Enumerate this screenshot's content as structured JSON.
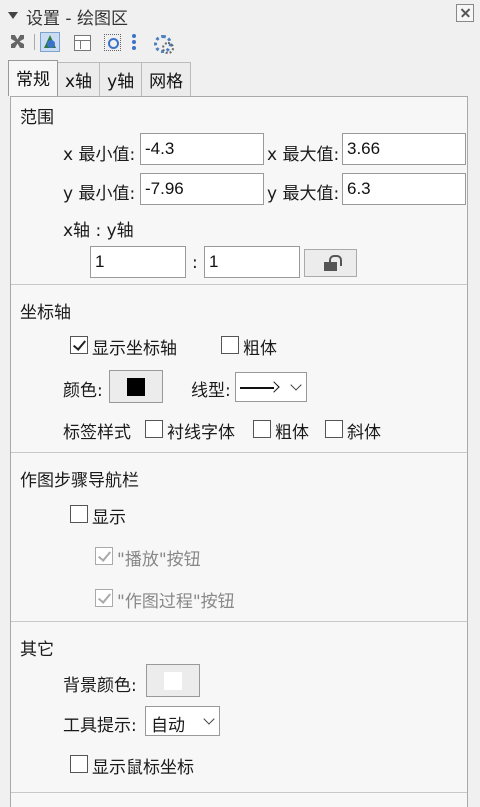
{
  "titlebar": {
    "title": "设置 - 绘图区"
  },
  "toolbar": {
    "icons": [
      "object-tool-icon",
      "graphics-icon",
      "layout-icon",
      "algebra-icon",
      "more-icon",
      "advanced-settings-icon"
    ]
  },
  "tabs": [
    "常规",
    "x轴",
    "y轴",
    "网格"
  ],
  "active_tab": "常规",
  "range": {
    "title": "范围",
    "xmin_label": "x 最小值:",
    "xmin_value": "-4.3",
    "xmax_label": "x 最大值:",
    "xmax_value": "3.66",
    "ymin_label": "y 最小值:",
    "ymin_value": "-7.96",
    "ymax_label": "y 最大值:",
    "ymax_value": "6.3",
    "ratio_label": "x轴 : y轴",
    "ratio_x": "1",
    "ratio_sep": ":",
    "ratio_y": "1"
  },
  "axes": {
    "title": "坐标轴",
    "show_axes_label": "显示坐标轴",
    "show_axes_checked": true,
    "bold_label": "粗体",
    "bold_checked": false,
    "color_label": "颜色:",
    "color": "#000000",
    "line_style_label": "线型:",
    "label_style_label": "标签样式",
    "serif_label": "衬线字体",
    "bold2_label": "粗体",
    "italic_label": "斜体"
  },
  "nav_bar": {
    "title": "作图步骤导航栏",
    "show_label": "显示",
    "play_button_label": "\"播放\"按钮",
    "construction_button_label": "\"作图过程\"按钮"
  },
  "other": {
    "title": "其它",
    "bg_color_label": "背景颜色:",
    "bg_color": "#ffffff",
    "tooltip_label": "工具提示:",
    "tooltip_value": "自动",
    "show_mouse_coords_label": "显示鼠标坐标"
  }
}
